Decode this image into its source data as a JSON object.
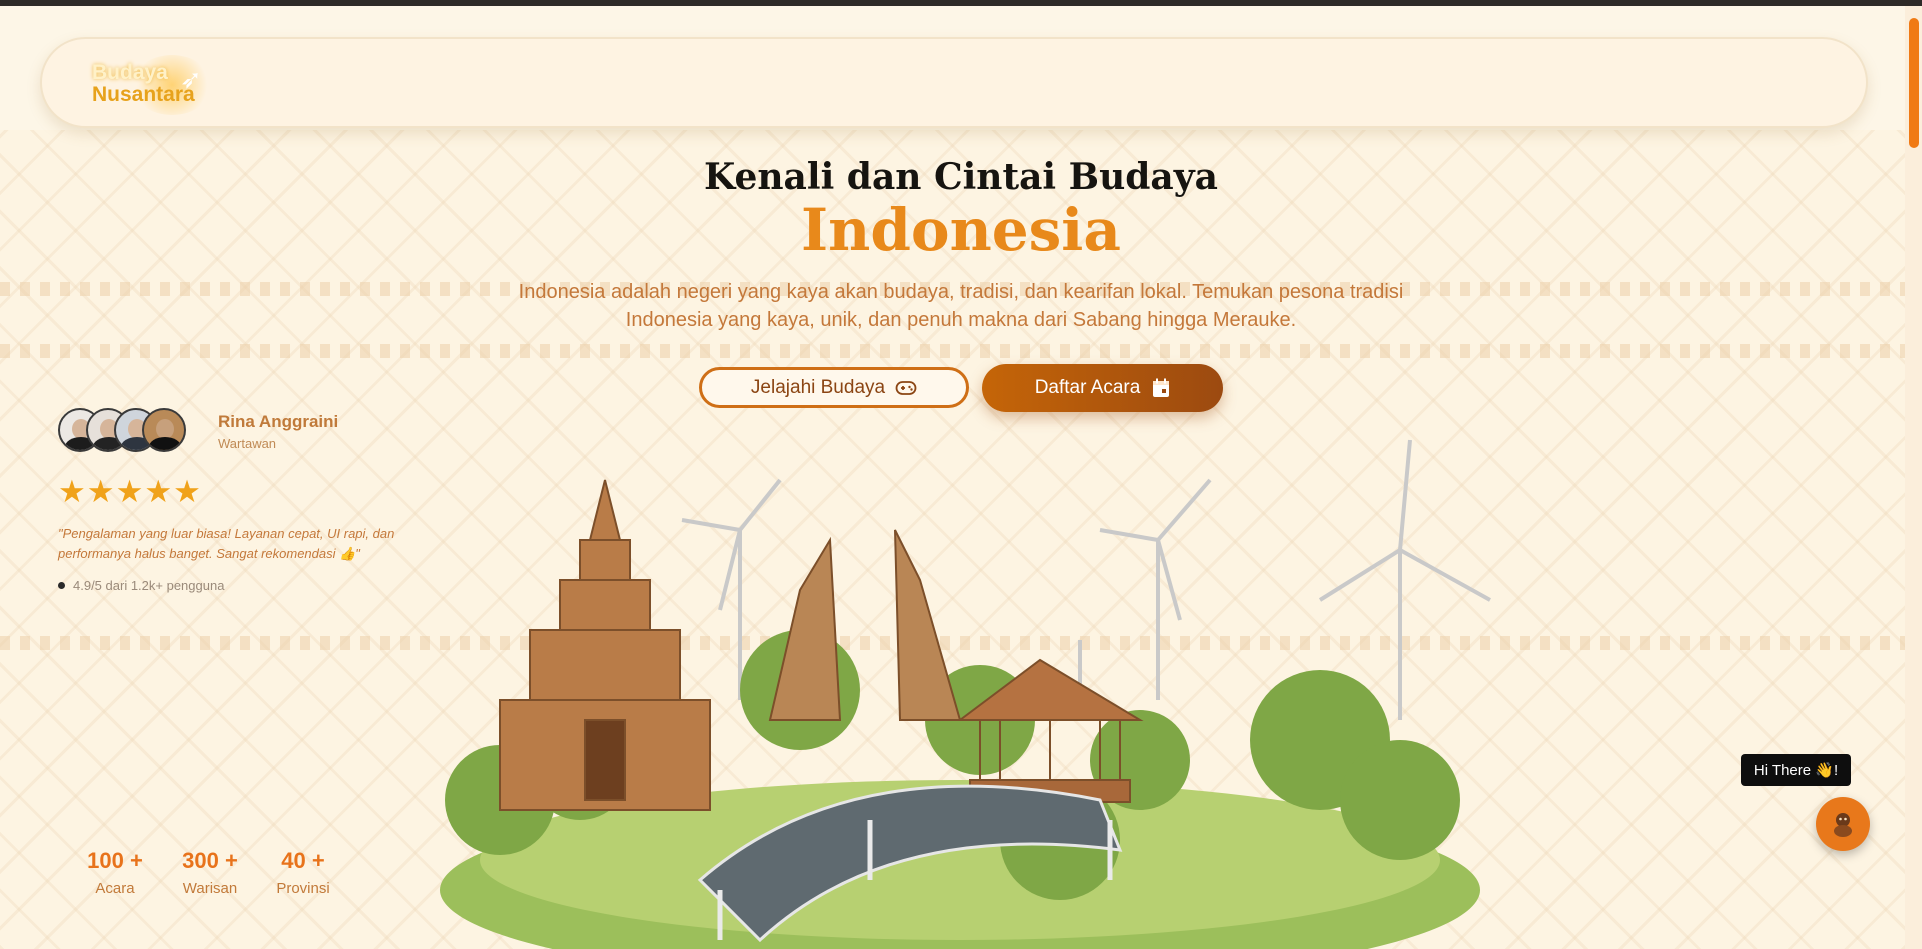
{
  "brand": {
    "logo_top": "Budaya",
    "logo_bottom": "Nusantara"
  },
  "hero": {
    "title": "Kenali dan Cintai Budaya",
    "accent": "Indonesia",
    "description": "Indonesia adalah negeri yang kaya akan budaya, tradisi, dan kearifan lokal. Temukan pesona tradisi Indonesia yang kaya, unik, dan penuh makna dari Sabang hingga Merauke."
  },
  "buttons": {
    "explore_label": "Jelajahi Budaya",
    "explore_icon": "gamepad-icon",
    "register_label": "Daftar Acara",
    "register_icon": "calendar-icon"
  },
  "testimonial": {
    "name": "Rina Anggraini",
    "role": "Wartawan",
    "stars": "★★★★★",
    "quote": "\"Pengalaman yang luar biasa! Layanan cepat, UI rapi, dan performanya halus banget. Sangat rekomendasi 👍\"",
    "rating": "4.9/5 dari 1.2k+ pengguna"
  },
  "stats": [
    {
      "value": "100 +",
      "label": "Acara"
    },
    {
      "value": "300 +",
      "label": "Warisan"
    },
    {
      "value": "40 +",
      "label": "Provinsi"
    }
  ],
  "chat": {
    "tooltip": "Hi There 👋!",
    "icon": "mascot-icon"
  },
  "colors": {
    "accent": "#e8891b",
    "button_dark": "#9c4a10",
    "background": "#fdf6e7"
  }
}
